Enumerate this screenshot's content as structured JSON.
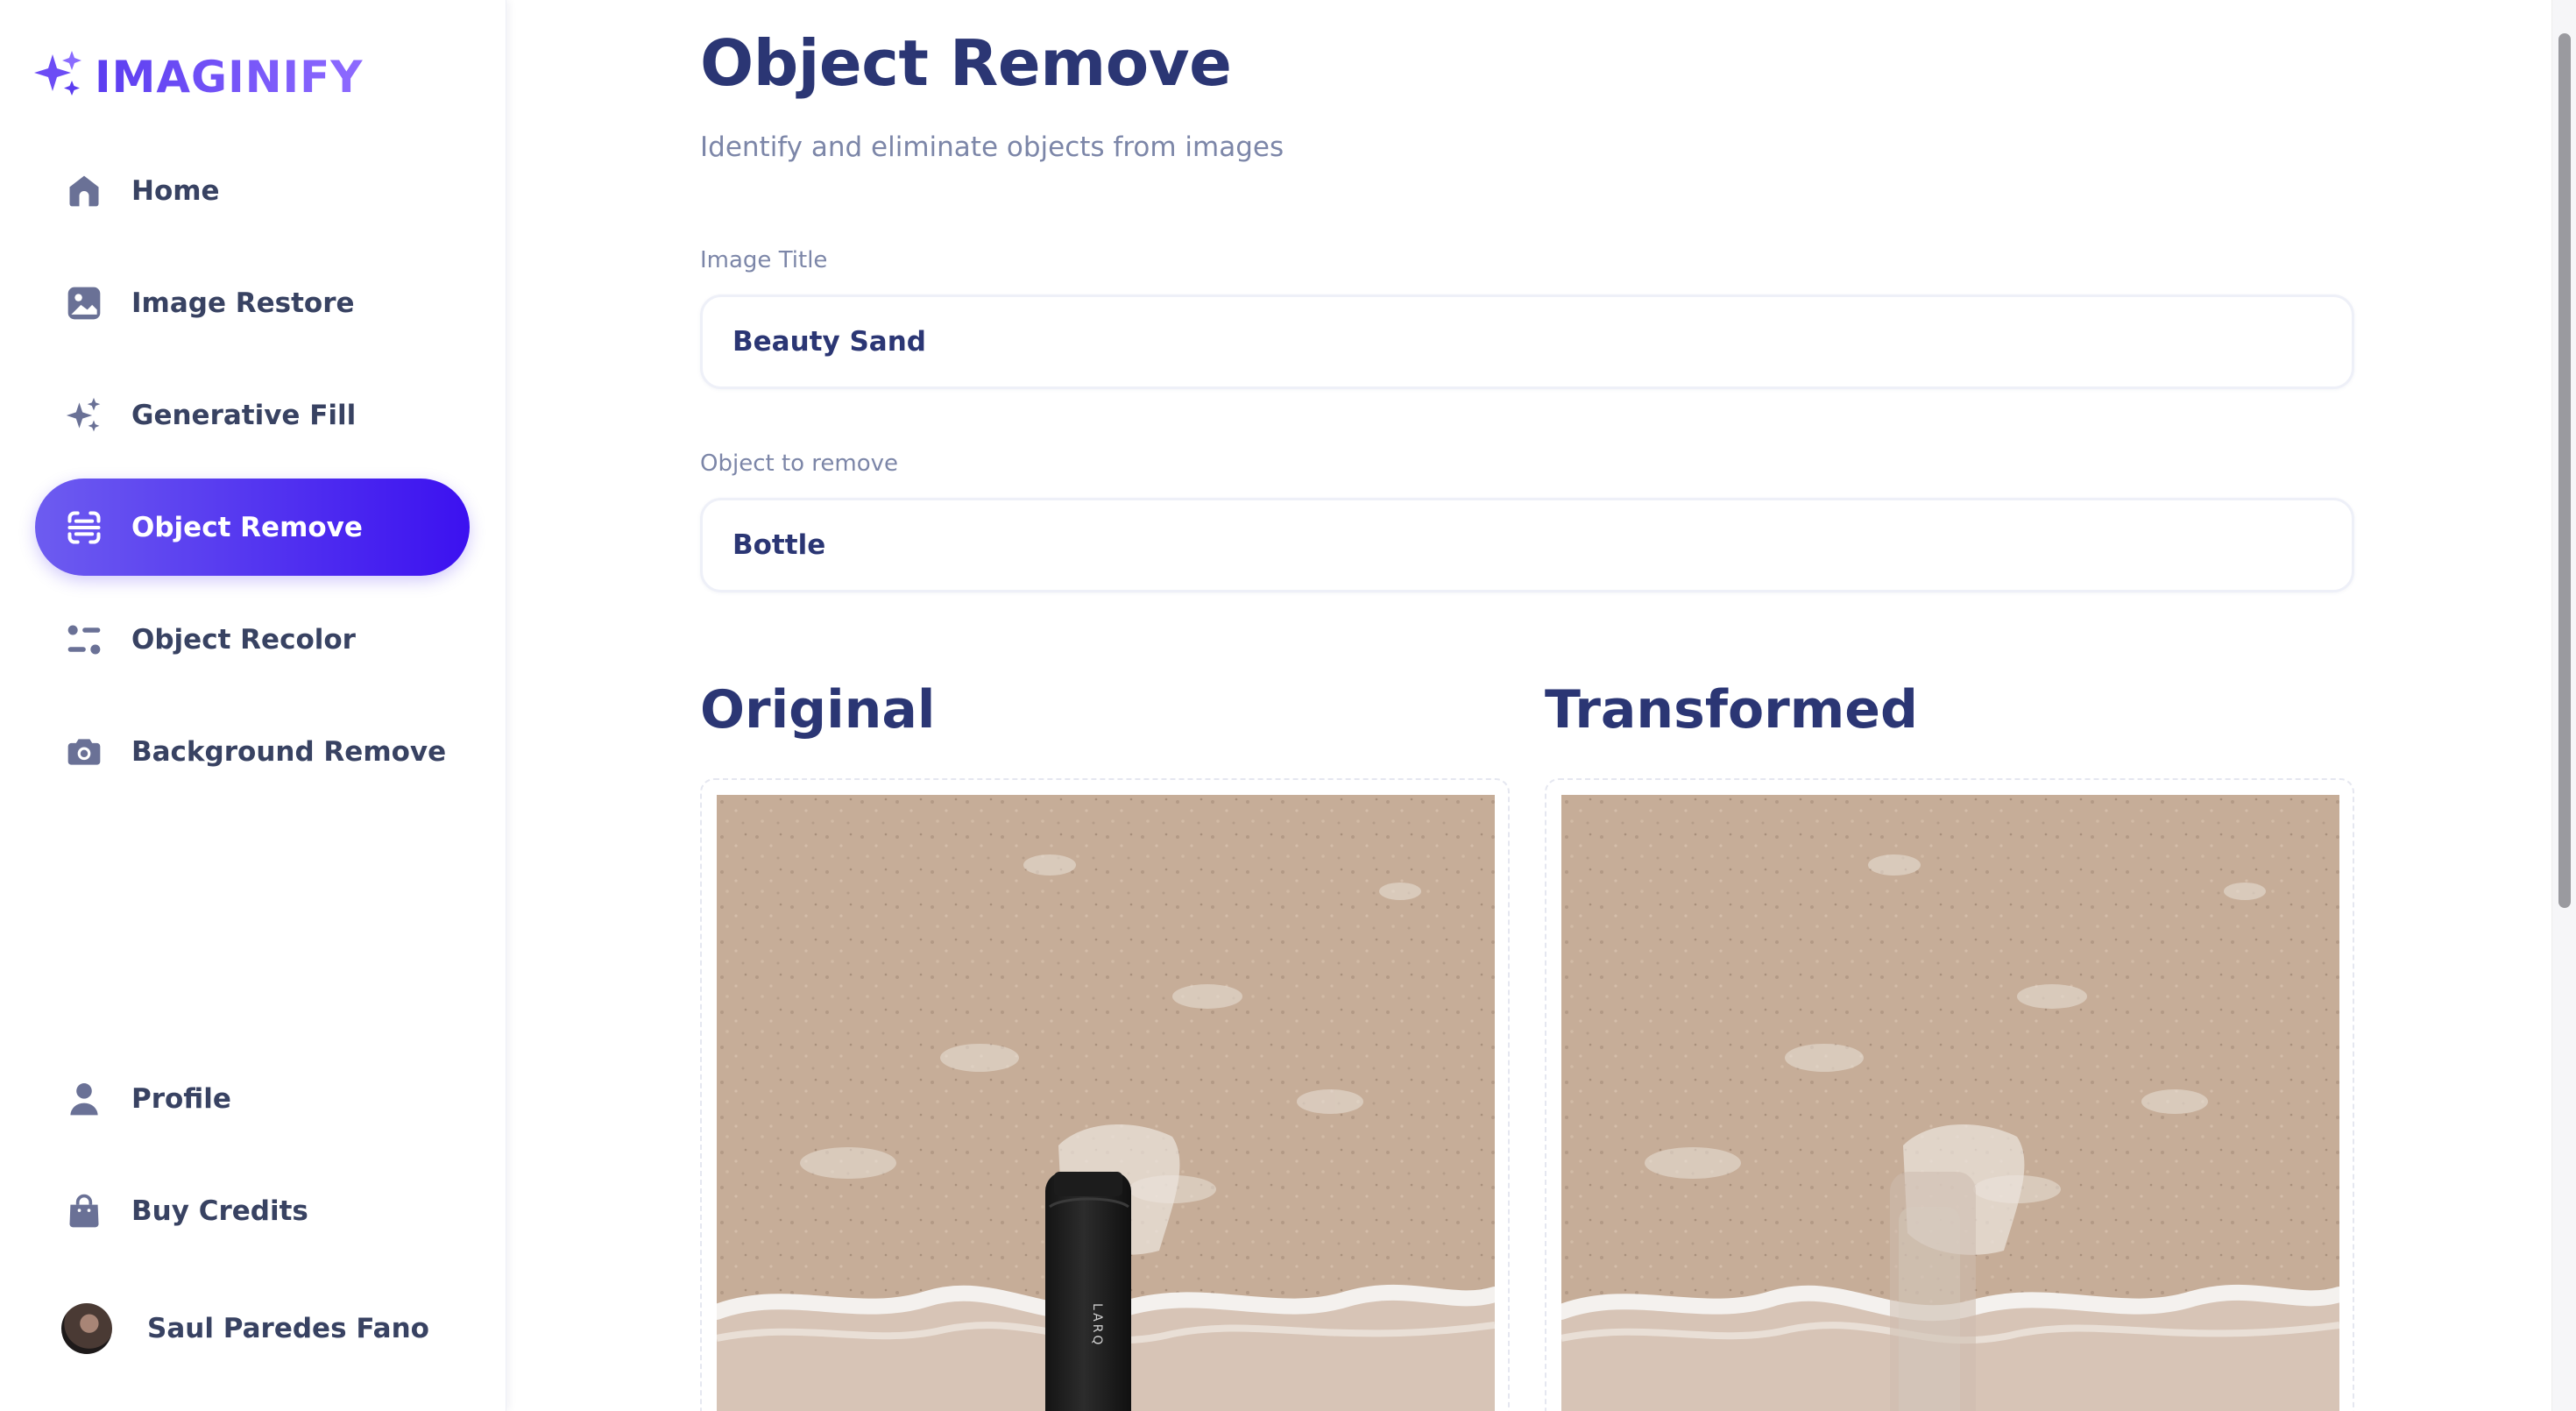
{
  "app": {
    "brand": "IMAGINIFY",
    "accent": "#5b3df0"
  },
  "sidebar": {
    "items": [
      {
        "label": "Home",
        "icon": "home-icon"
      },
      {
        "label": "Image Restore",
        "icon": "image-icon"
      },
      {
        "label": "Generative Fill",
        "icon": "sparkles-icon"
      },
      {
        "label": "Object Remove",
        "icon": "scan-icon",
        "active": true
      },
      {
        "label": "Object Recolor",
        "icon": "filter-icon"
      },
      {
        "label": "Background Remove",
        "icon": "camera-icon"
      }
    ],
    "bottom_items": [
      {
        "label": "Profile",
        "icon": "user-icon"
      },
      {
        "label": "Buy Credits",
        "icon": "shopping-bag-icon"
      }
    ],
    "user": {
      "name": "Saul Paredes Fano"
    }
  },
  "main": {
    "title": "Object Remove",
    "subtitle": "Identify and eliminate objects from images",
    "fields": {
      "image_title": {
        "label": "Image Title",
        "value": "Beauty Sand"
      },
      "object_to_remove": {
        "label": "Object to remove",
        "value": "Bottle"
      }
    },
    "original": {
      "heading": "Original",
      "bottle_label": "LARQ"
    },
    "transformed": {
      "heading": "Transformed"
    }
  }
}
